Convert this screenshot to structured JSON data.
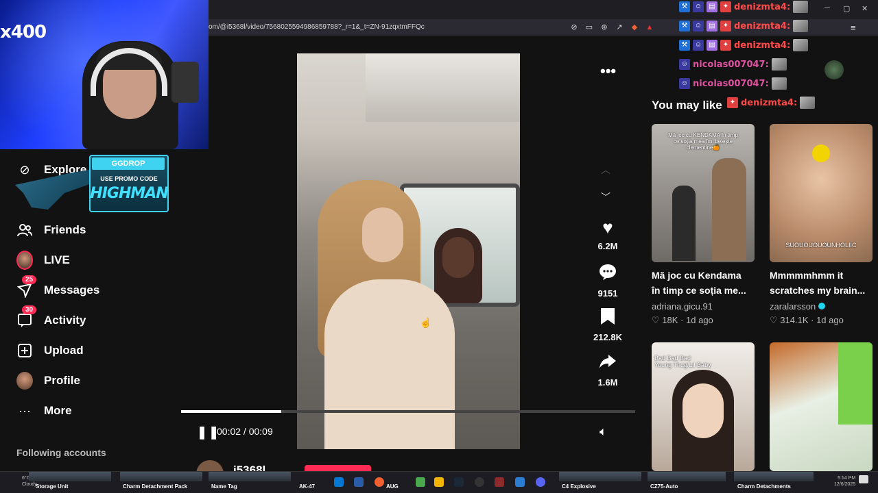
{
  "browser": {
    "url": "om/@i5368l/video/7568025594986859788?_r=1&_t=ZN-91zqxtmFFQc"
  },
  "stream_overlay": {
    "counter": "x400",
    "ad": {
      "brand": "GGDROP",
      "promo_label": "USE PROMO CODE",
      "promo_code": "HIGHMAN"
    }
  },
  "sidebar": {
    "explore_label": "Explore",
    "items": [
      {
        "label": "Friends",
        "icon": "friends-icon"
      },
      {
        "label": "LIVE",
        "icon": "live-avatar"
      },
      {
        "label": "Messages",
        "icon": "messages-icon",
        "badge": "25"
      },
      {
        "label": "Activity",
        "icon": "activity-icon",
        "badge": "30"
      },
      {
        "label": "Upload",
        "icon": "upload-icon"
      },
      {
        "label": "Profile",
        "icon": "profile-avatar"
      },
      {
        "label": "More",
        "icon": "more-icon"
      }
    ],
    "following_label": "Following accounts"
  },
  "video": {
    "likes": "6.2M",
    "comments": "9151",
    "saves": "212.8K",
    "shares": "1.6M",
    "current_time": "00:02",
    "duration": "00:09",
    "time_display": "00:02 / 00:09",
    "progress_fraction": 0.22,
    "author": "i5368l"
  },
  "recommendations": {
    "heading": "You may like",
    "items": [
      {
        "title_line1": "Mă joc cu Kendama",
        "title_line2": "în timp ce soția me...",
        "user": "adriana.gicu.91",
        "likes": "18K",
        "age": "1d ago",
        "caption": "Mă joc cu KENDAMA în timp ce soția mea îmi belește clementine🍊"
      },
      {
        "title_line1": "Mmmmmhmm it",
        "title_line2": "scratches my brain...",
        "user": "zaralarsson",
        "verified": true,
        "likes": "314.1K",
        "age": "1d ago",
        "caption": "SUOUOUOUOUNHOLIIC"
      },
      {
        "caption": "Bad Bad Bad\nYoung Thug/Lil Baby"
      },
      {
        "caption": ""
      }
    ]
  },
  "chat": [
    {
      "user": "denizmta4:",
      "color": "#ff4a4a"
    },
    {
      "user": "denizmta4:",
      "color": "#ff4a4a"
    },
    {
      "user": "denizmta4:",
      "color": "#ff4a4a"
    },
    {
      "user": "nicolas007047:",
      "color": "#e052a0"
    },
    {
      "user": "nicolas007047:",
      "color": "#e052a0"
    },
    {
      "user": "denizmta4:",
      "color": "#ff4a4a"
    }
  ],
  "taskbar": {
    "weather_temp": "6°C",
    "weather_desc": "Cloudy",
    "items": [
      "Storage Unit",
      "Charm Detachment Pack",
      "Name Tag",
      "AK-47",
      "AUG",
      "C4 Explosive",
      "CZ75-Auto",
      "Charm Detachments"
    ],
    "clock_time": "5:14 PM",
    "clock_date": "12/6/2025"
  },
  "colors": {
    "accent": "#fe2c55",
    "background": "#121212",
    "verified": "#20d5ec"
  }
}
